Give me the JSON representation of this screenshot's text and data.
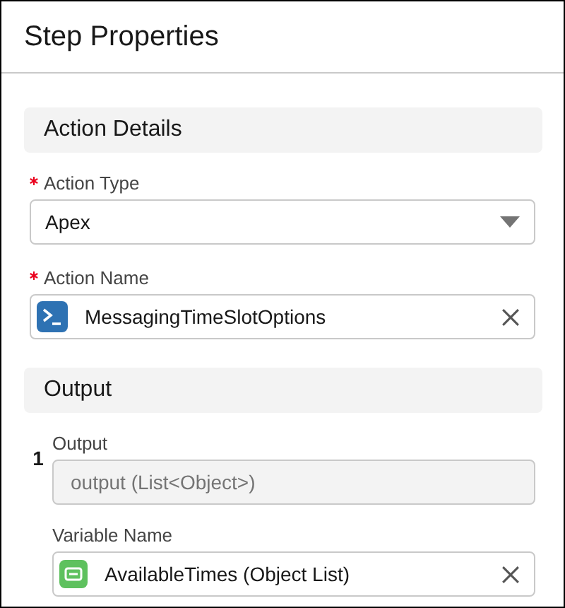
{
  "panel": {
    "title": "Step Properties"
  },
  "action_details": {
    "heading": "Action Details",
    "action_type": {
      "label": "Action Type",
      "required": true,
      "value": "Apex"
    },
    "action_name": {
      "label": "Action Name",
      "required": true,
      "value": "MessagingTimeSlotOptions"
    }
  },
  "output": {
    "heading": "Output",
    "items": [
      {
        "index": "1",
        "output": {
          "label": "Output",
          "value": "output (List<Object>)",
          "disabled": true
        },
        "variable": {
          "label": "Variable Name",
          "value": "AvailableTimes (Object List)"
        }
      }
    ]
  }
}
